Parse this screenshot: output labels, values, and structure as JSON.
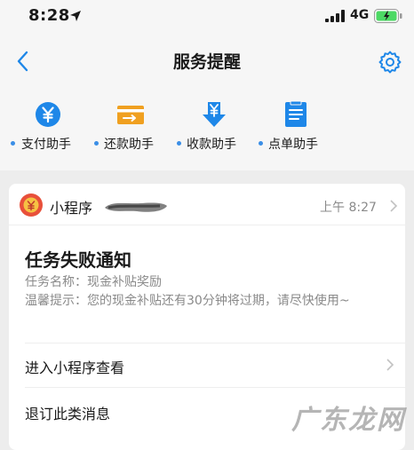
{
  "status_bar": {
    "time": "8:28",
    "network": "4G"
  },
  "header": {
    "title": "服务提醒"
  },
  "shortcuts": [
    {
      "label": "支付助手",
      "icon": "yen-circle-icon"
    },
    {
      "label": "还款助手",
      "icon": "card-arrow-icon"
    },
    {
      "label": "收款助手",
      "icon": "yen-download-icon"
    },
    {
      "label": "点单助手",
      "icon": "order-list-icon"
    }
  ],
  "card": {
    "app_name": "小程序",
    "timestamp": "上午 8:27",
    "message_title": "任务失败通知",
    "task_name": "任务名称：现金补贴奖励",
    "tip": "温馨提示：您的现金补贴还有30分钟将过期，请尽快使用~",
    "action_view": "进入小程序查看",
    "action_unsubscribe": "退订此类消息"
  },
  "watermark": "广东龙网",
  "colors": {
    "accent": "#1e87e8",
    "orange": "#f0a020",
    "background": "#ededed"
  }
}
